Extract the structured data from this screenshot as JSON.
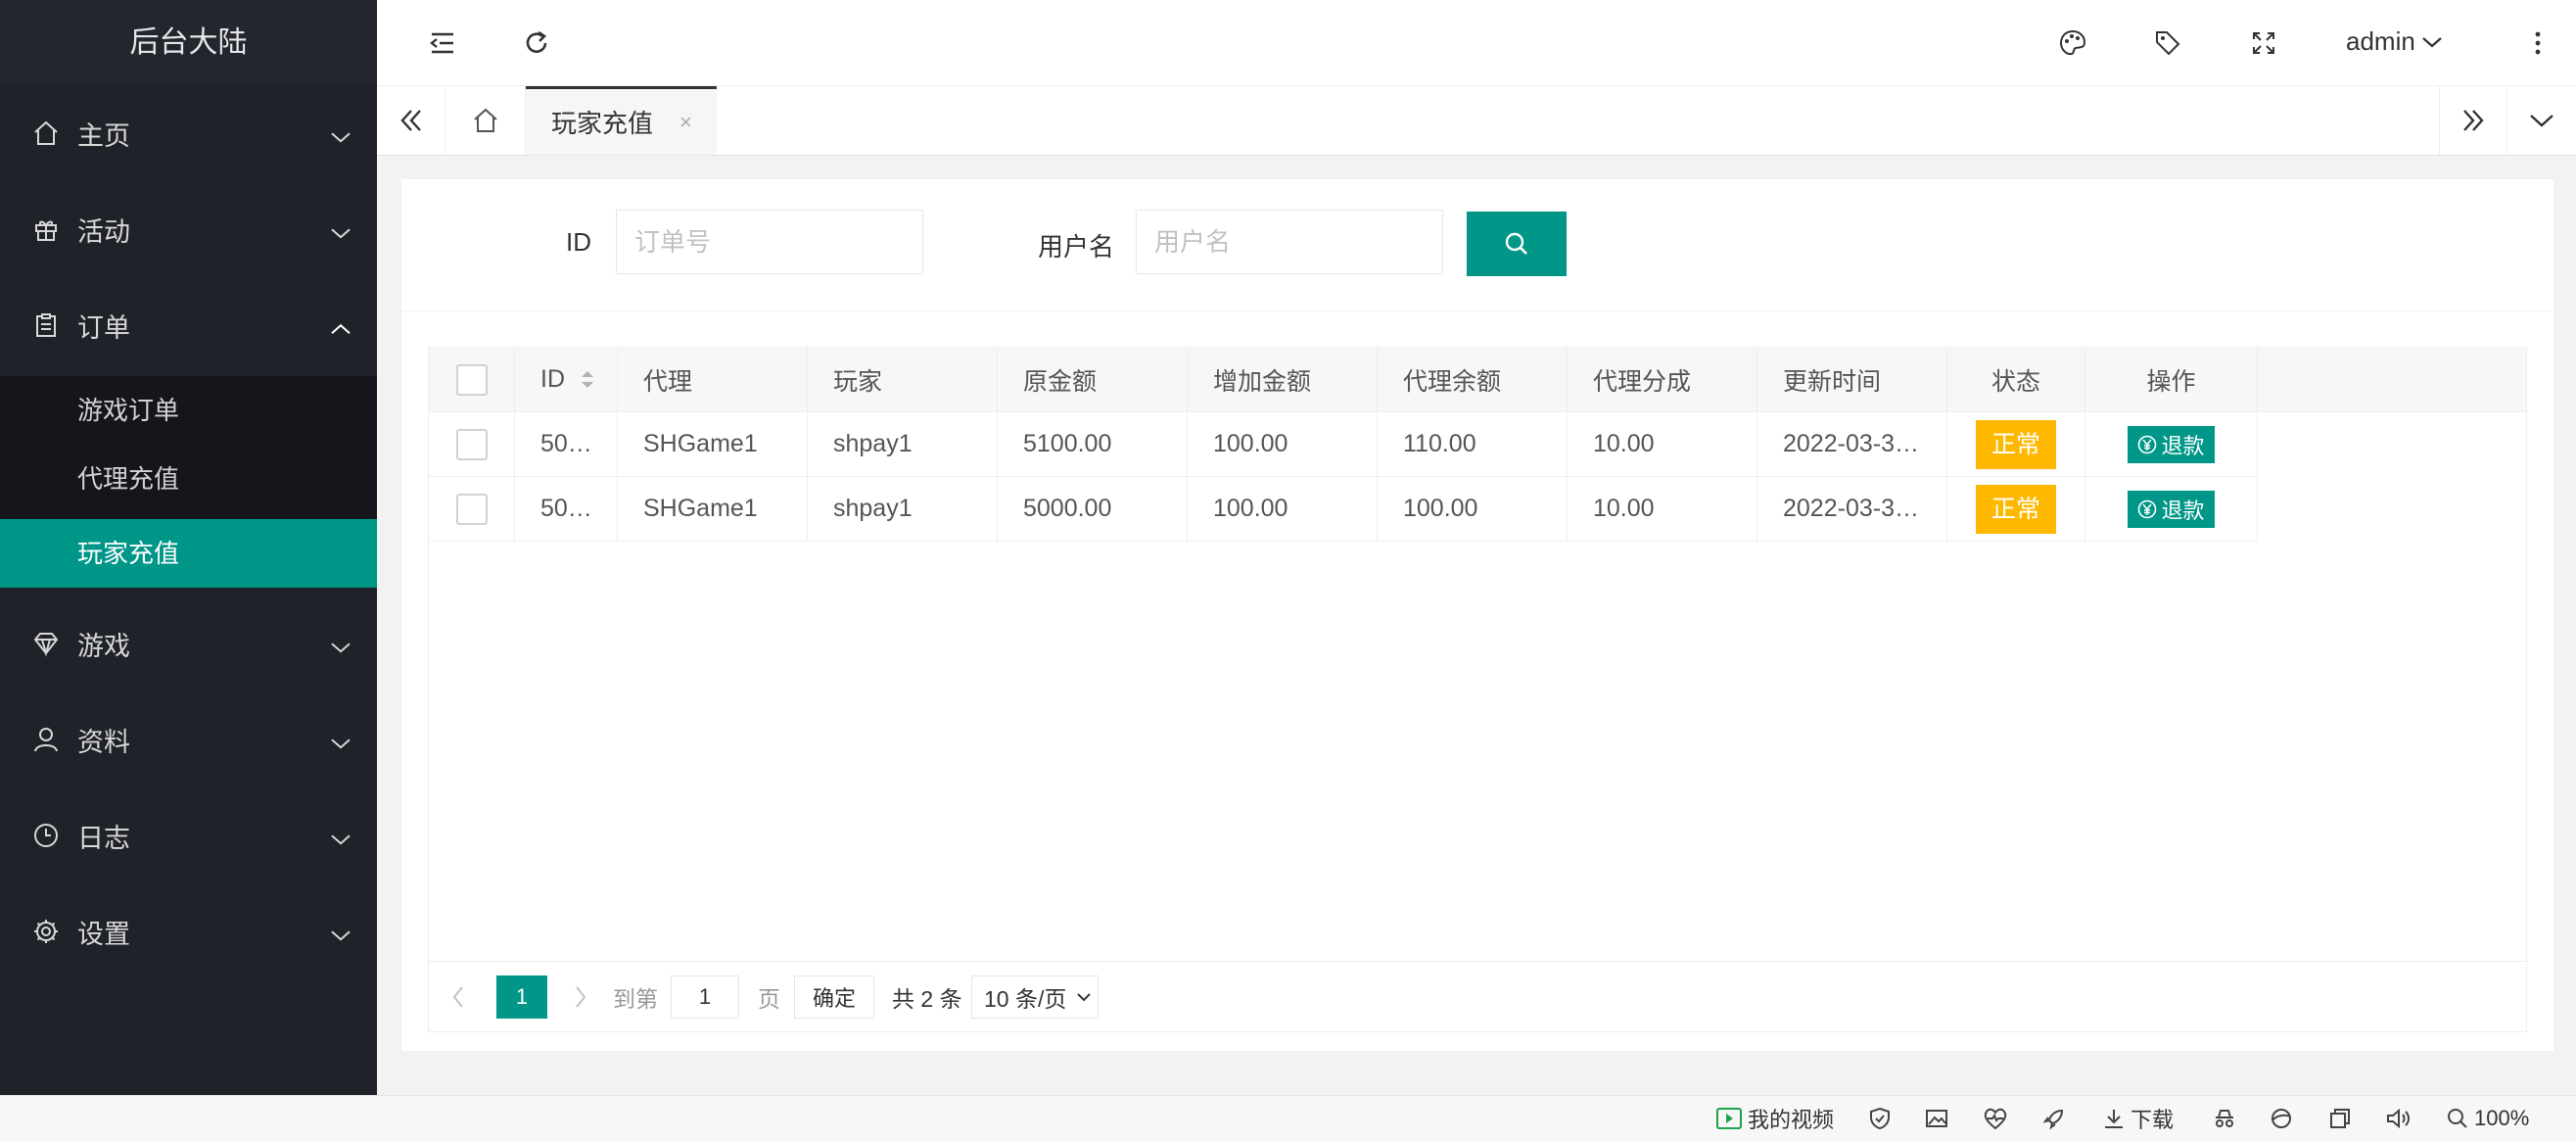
{
  "app": {
    "title": "后台大陆"
  },
  "sidebar": {
    "items": [
      {
        "label": "主页",
        "icon": "home-icon"
      },
      {
        "label": "活动",
        "icon": "gift-icon"
      },
      {
        "label": "订单",
        "icon": "clipboard-icon",
        "expanded": true
      },
      {
        "label": "游戏",
        "icon": "diamond-icon"
      },
      {
        "label": "资料",
        "icon": "user-icon"
      },
      {
        "label": "日志",
        "icon": "clock-icon"
      },
      {
        "label": "设置",
        "icon": "gear-icon"
      }
    ],
    "sub_items": [
      {
        "label": "游戏订单",
        "active": false
      },
      {
        "label": "代理充值",
        "active": false
      },
      {
        "label": "玩家充值",
        "active": true
      }
    ]
  },
  "header": {
    "user": "admin"
  },
  "tabs": {
    "active_label": "玩家充值",
    "close_glyph": "×"
  },
  "filter": {
    "id_label": "ID",
    "id_placeholder": "订单号",
    "username_label": "用户名",
    "username_placeholder": "用户名"
  },
  "table": {
    "columns": [
      "ID",
      "代理",
      "玩家",
      "原金额",
      "增加金额",
      "代理余额",
      "代理分成",
      "更新时间",
      "状态",
      "操作"
    ],
    "rows": [
      {
        "id": "50…",
        "agent": "SHGame1",
        "player": "shpay1",
        "original": "5100.00",
        "added": "100.00",
        "agent_balance": "110.00",
        "agent_share": "10.00",
        "updated": "2022-03-3…",
        "status": "正常",
        "action": "退款"
      },
      {
        "id": "50…",
        "agent": "SHGame1",
        "player": "shpay1",
        "original": "5000.00",
        "added": "100.00",
        "agent_balance": "100.00",
        "agent_share": "10.00",
        "updated": "2022-03-3…",
        "status": "正常",
        "action": "退款"
      }
    ],
    "colors": {
      "accent": "#009688",
      "status": "#ffb800"
    }
  },
  "pager": {
    "current": "1",
    "goto_label": "到第",
    "goto_value": "1",
    "page_label": "页",
    "confirm": "确定",
    "total": "共 2 条",
    "page_size": "10 条/页"
  },
  "statusbar": {
    "video": "我的视频",
    "download": "下载",
    "zoom": "100%"
  }
}
